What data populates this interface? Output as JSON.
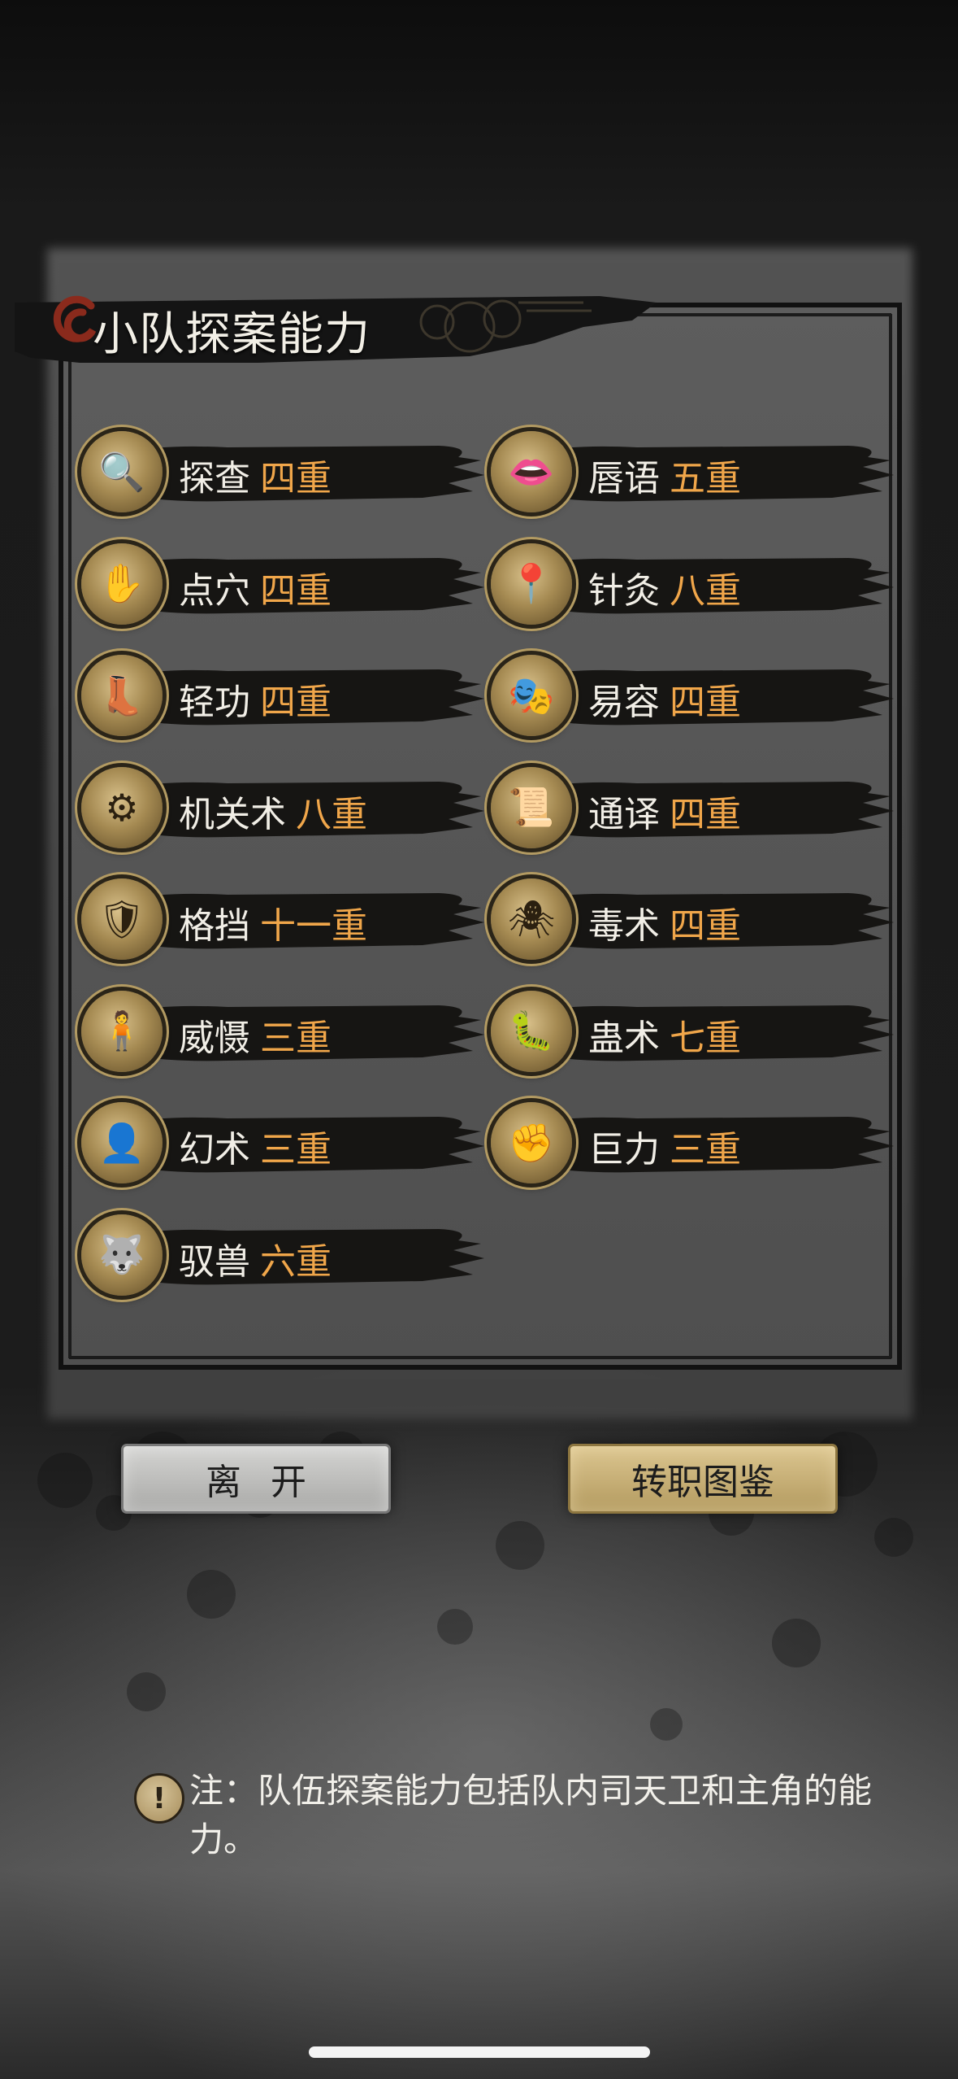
{
  "panel": {
    "title": "小队探案能力"
  },
  "abilities": [
    {
      "name": "探查",
      "level": "四重",
      "icon": "investigate-icon",
      "glyph": "🔍"
    },
    {
      "name": "唇语",
      "level": "五重",
      "icon": "lip-reading-icon",
      "glyph": "👄"
    },
    {
      "name": "点穴",
      "level": "四重",
      "icon": "acupoint-icon",
      "glyph": "✋"
    },
    {
      "name": "针灸",
      "level": "八重",
      "icon": "acupuncture-icon",
      "glyph": "📍"
    },
    {
      "name": "轻功",
      "level": "四重",
      "icon": "lightness-skill-icon",
      "glyph": "👢"
    },
    {
      "name": "易容",
      "level": "四重",
      "icon": "disguise-icon",
      "glyph": "🎭"
    },
    {
      "name": "机关术",
      "level": "八重",
      "icon": "mechanism-icon",
      "glyph": "⚙"
    },
    {
      "name": "通译",
      "level": "四重",
      "icon": "translate-icon",
      "glyph": "📜"
    },
    {
      "name": "格挡",
      "level": "十一重",
      "icon": "block-icon",
      "glyph": "🛡"
    },
    {
      "name": "毒术",
      "level": "四重",
      "icon": "poison-spider-icon",
      "glyph": "🕷"
    },
    {
      "name": "威慑",
      "level": "三重",
      "icon": "intimidate-icon",
      "glyph": "🧍"
    },
    {
      "name": "蛊术",
      "level": "七重",
      "icon": "gu-worm-icon",
      "glyph": "🐛"
    },
    {
      "name": "幻术",
      "level": "三重",
      "icon": "illusion-hood-icon",
      "glyph": "👤"
    },
    {
      "name": "巨力",
      "level": "三重",
      "icon": "strength-fist-icon",
      "glyph": "✊"
    },
    {
      "name": "驭兽",
      "level": "六重",
      "icon": "beast-taming-wolf-icon",
      "glyph": "🐺"
    }
  ],
  "buttons": {
    "leave": "离开",
    "career": "转职图鉴"
  },
  "note": {
    "text": "注：队伍探案能力包括队内司天卫和主角的能力。",
    "icon": "exclamation-icon"
  },
  "colors": {
    "level_accent": "#f0a64a",
    "label_text": "#f1eee6"
  }
}
